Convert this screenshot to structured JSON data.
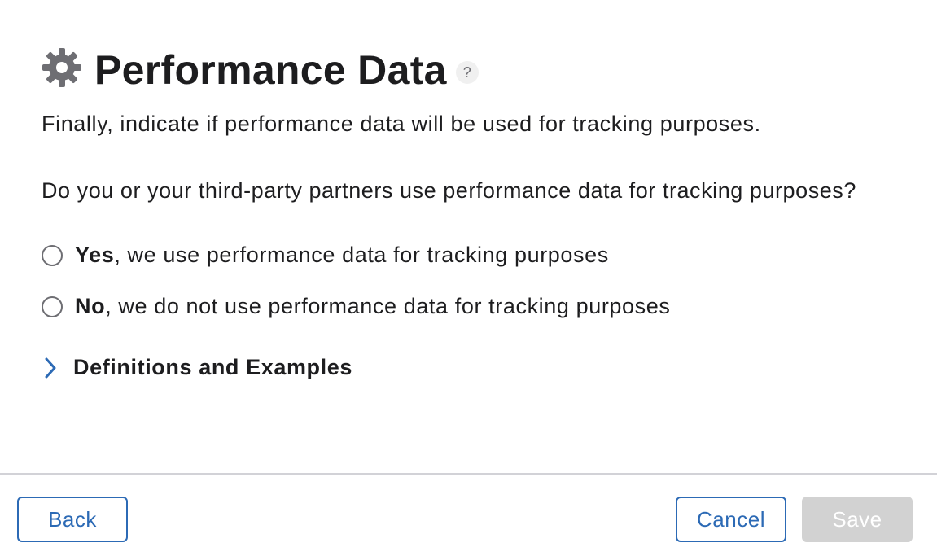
{
  "header": {
    "icon": "gear-icon",
    "title": "Performance Data",
    "help_label": "?"
  },
  "intro": "Finally, indicate if performance data will be used for tracking purposes.",
  "question": "Do you or your third-party partners use performance data for tracking purposes?",
  "options": [
    {
      "bold": "Yes",
      "rest": ", we use performance data for tracking purposes",
      "selected": false
    },
    {
      "bold": "No",
      "rest": ", we do not use performance data for tracking purposes",
      "selected": false
    }
  ],
  "disclosure": {
    "icon": "chevron-right-icon",
    "label": "Definitions and Examples"
  },
  "footer": {
    "back_label": "Back",
    "cancel_label": "Cancel",
    "save_label": "Save",
    "save_enabled": false
  },
  "colors": {
    "accent": "#2c6ab5",
    "gear": "#6e6e73",
    "disabled_button": "#d2d2d2",
    "divider": "#d2d2d7"
  }
}
